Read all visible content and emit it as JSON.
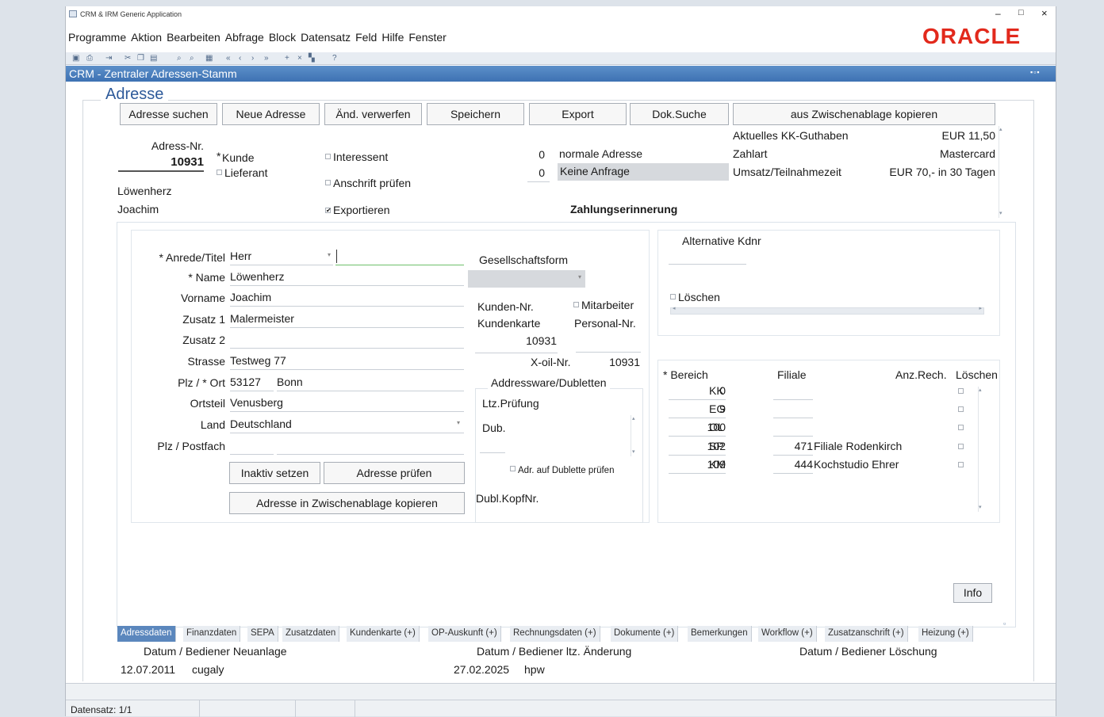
{
  "window": {
    "title": "CRM & IRM Generic Application",
    "minimize": "–",
    "maximize": "□",
    "close": "×"
  },
  "menu": [
    "Programme",
    "Aktion",
    "Bearbeiten",
    "Abfrage",
    "Block",
    "Datensatz",
    "Feld",
    "Hilfe",
    "Fenster"
  ],
  "brand": "ORACLE",
  "form_title": "CRM - Zentraler Adressen-Stamm",
  "section_title": "Adresse",
  "buttons": {
    "search": "Adresse suchen",
    "new": "Neue Adresse",
    "discard": "Änd. verwerfen",
    "save": "Speichern",
    "export": "Export",
    "docsearch": "Dok.Suche",
    "clipboard_copy": "aus Zwischenablage kopieren",
    "set_inactive": "Inaktiv setzen",
    "check_address": "Adresse prüfen",
    "copy_to_clipboard": "Adresse in Zwischenablage kopieren",
    "info": "Info"
  },
  "header": {
    "adress_nr_label": "Adress-Nr.",
    "adress_nr": "10931",
    "lastname": "Löwenherz",
    "firstname": "Joachim",
    "kunde": "Kunde",
    "lieferant": "Lieferant",
    "interessent": "Interessent",
    "anschrift_pruefen": "Anschrift prüfen",
    "exportieren": "Exportieren",
    "count1": "0",
    "count1_label": "normale Adresse",
    "count2": "0",
    "count2_label": "Keine Anfrage",
    "reminder": "Zahlungserinnerung",
    "kk_label": "Aktuelles KK-Guthaben",
    "kk_value": "EUR 11,50",
    "payment_label": "Zahlart",
    "payment_value": "Mastercard",
    "turnover_label": "Umsatz/Teilnahmezeit",
    "turnover_value": "EUR 70,- in 30 Tagen"
  },
  "address": {
    "anrede_label": "* Anrede/Titel",
    "anrede": "Herr",
    "name_label": "* Name",
    "name": "Löwenherz",
    "vorname_label": "Vorname",
    "vorname": "Joachim",
    "zusatz1_label": "Zusatz 1",
    "zusatz1": "Malermeister",
    "zusatz2_label": "Zusatz 2",
    "zusatz2": "",
    "strasse_label": "Strasse",
    "strasse": "Testweg 77",
    "plz_label": "Plz / * Ort",
    "plz": "53127",
    "ort": "Bonn",
    "ortsteil_label": "Ortsteil",
    "ortsteil": "Venusberg",
    "land_label": "Land",
    "land": "Deutschland",
    "postfach_label": "Plz / Postfach",
    "postfach": ""
  },
  "middle": {
    "gesellschaftsform": "Gesellschaftsform",
    "kunden_nr": "Kunden-Nr.",
    "kundenkarte": "Kundenkarte",
    "kundenkarte_value": "10931",
    "mitarbeiter": "Mitarbeiter",
    "personal_nr": "Personal-Nr.",
    "xoil_label": "X-oil-Nr.",
    "xoil_value": "10931",
    "dubletten_title": "Addressware/Dubletten",
    "ltz": "Ltz.Prüfung",
    "dub": "Dub.",
    "adr_dublette": "Adr. auf Dublette prüfen",
    "dubl_kopf": "Dubl.KopfNr."
  },
  "right": {
    "alt_kdnr": "Alternative Kdnr",
    "loeschen": "Löschen",
    "table_headers": [
      "* Bereich",
      "Filiale",
      "Anz.Rech.",
      "Löschen"
    ],
    "rows": [
      {
        "num": "0",
        "code": "KK",
        "filiale_num": "",
        "filiale": ""
      },
      {
        "num": "9",
        "code": "EG",
        "filiale_num": "",
        "filiale": ""
      },
      {
        "num": "100",
        "code": "OL",
        "filiale_num": "",
        "filiale": ""
      },
      {
        "num": "102",
        "code": "SP",
        "filiale_num": "471",
        "filiale": "Filiale Rodenkirch"
      },
      {
        "num": "109",
        "code": "KM",
        "filiale_num": "444",
        "filiale": "Kochstudio Ehrer"
      }
    ]
  },
  "tabs": [
    "Adressdaten",
    "Finanzdaten",
    "SEPA",
    "Zusatzdaten",
    "Kundenkarte (+)",
    "OP-Auskunft (+)",
    "Rechnungsdaten (+)",
    "Dokumente (+)",
    "Bemerkungen",
    "Workflow (+)",
    "Zusatzanschrift (+)",
    "Heizung (+)"
  ],
  "footer": {
    "neuanlage_label": "Datum / Bediener Neuanlage",
    "neuanlage_date": "12.07.2011",
    "neuanlage_user": "cugaly",
    "aenderung_label": "Datum / Bediener ltz. Änderung",
    "aenderung_date": "27.02.2025",
    "aenderung_user": "hpw",
    "loeschung_label": "Datum / Bediener Löschung"
  },
  "status": {
    "datensatz": "Datensatz: 1/1"
  }
}
